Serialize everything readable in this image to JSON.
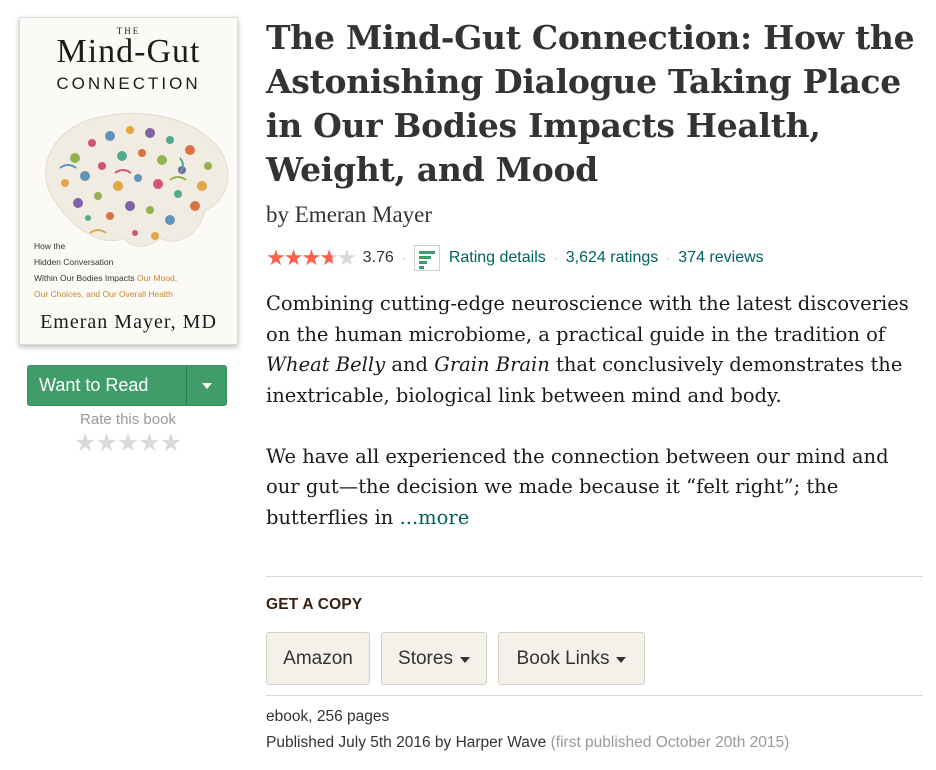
{
  "cover": {
    "the": "THE",
    "title": "Mind-Gut",
    "subtitle": "CONNECTION",
    "tagline_1": "How the",
    "tagline_2": "Hidden Conversation",
    "tagline_3a": "Within Our Bodies Impacts ",
    "tagline_3b": "Our Mood,",
    "tagline_4": "Our Choices, and Our Overall Health",
    "author": "Emeran Mayer, MD"
  },
  "shelf": {
    "want_to_read": "Want to Read",
    "rate_label": "Rate this book",
    "rate_stars": "★★★★★"
  },
  "book": {
    "title": "The Mind-Gut Connection: How the Astonishing Dialogue Taking Place in Our Bodies Impacts Health, Weight, and Mood",
    "by": "by",
    "author": "Emeran Mayer"
  },
  "rating": {
    "average": "3.76",
    "stars_filled": 3.76,
    "stars_max": 5,
    "details_label": "Rating details",
    "ratings": "3,624 ratings",
    "reviews": "374 reviews",
    "separator": "·"
  },
  "description": {
    "p1_a": "Combining cutting-edge neuroscience with the latest discoveries on the human microbiome, a practical guide in the tradition of ",
    "p1_b": "Wheat Belly",
    "p1_c": " and ",
    "p1_d": "Grain Brain",
    "p1_e": " that conclusively demonstrates the inextricable, biological link between mind and body.",
    "p2": "We have all experienced the connection between our mind and our gut—the decision we made because it “felt right”; the butterflies in ",
    "more": "...more"
  },
  "get_copy": {
    "heading": "GET A COPY",
    "amazon": "Amazon",
    "stores": "Stores",
    "book_links": "Book Links"
  },
  "details": {
    "format": "ebook, 256 pages",
    "published": "Published July 5th 2016 by Harper Wave",
    "first_published": "(first published October 20th 2015)"
  },
  "colors": {
    "star": "#fa604a",
    "green_button": "#409d69",
    "link": "#00635d",
    "brown_heading": "#382110"
  }
}
